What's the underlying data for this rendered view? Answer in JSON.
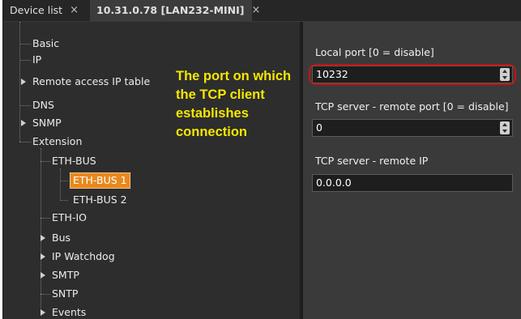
{
  "tabs": [
    {
      "label": "Device list",
      "close": "×"
    },
    {
      "label": "10.31.0.78 [LAN232-MINI]",
      "close": "×"
    }
  ],
  "tree": {
    "basic": "Basic",
    "ip": "IP",
    "remote_access": "Remote access IP table",
    "dns": "DNS",
    "snmp": "SNMP",
    "extension": "Extension",
    "eth_bus": "ETH-BUS",
    "eth_bus_1": "ETH-BUS 1",
    "eth_bus_2": "ETH-BUS 2",
    "eth_io": "ETH-IO",
    "bus": "Bus",
    "ip_watchdog": "IP Watchdog",
    "smtp": "SMTP",
    "sntp": "SNTP",
    "events": "Events"
  },
  "annotation": "The port on which the TCP client establishes connection",
  "form": {
    "local_port_label": "Local port [0 = disable]",
    "local_port_value": "10232",
    "remote_port_label": "TCP server - remote port [0 = disable]",
    "remote_port_value": "0",
    "remote_ip_label": "TCP server - remote IP",
    "remote_ip_value": "0.0.0.0"
  },
  "colors": {
    "selection": "#e8891d",
    "annotation": "#f5e600",
    "highlight": "#cc1010"
  }
}
